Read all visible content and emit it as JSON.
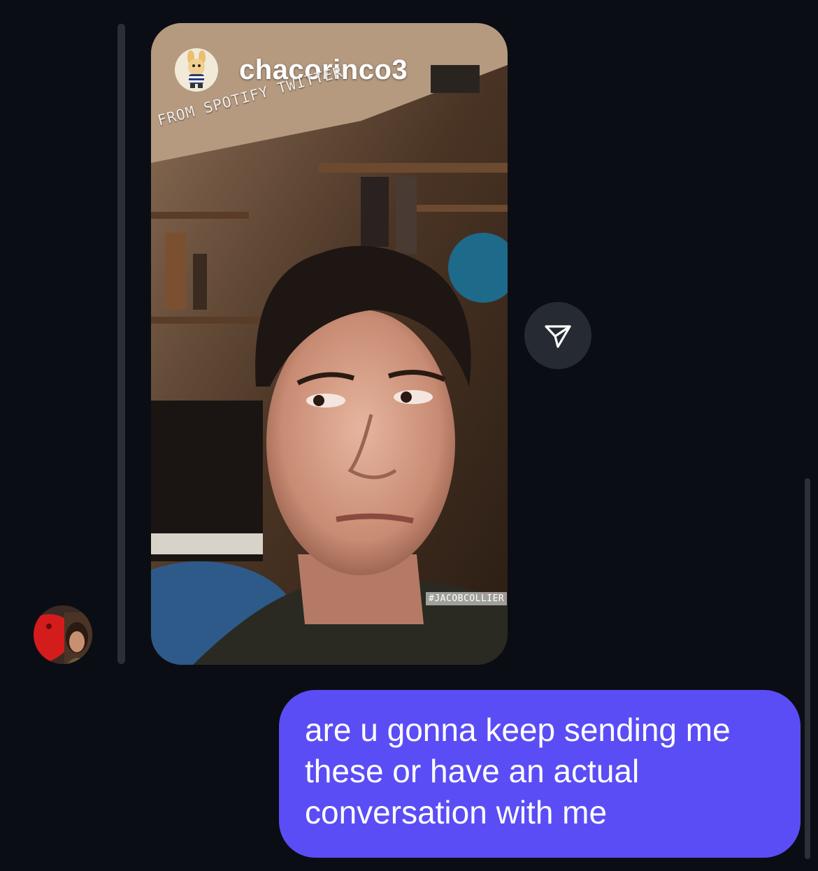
{
  "story": {
    "username": "chacorinco3",
    "caption": "FROM SPOTIFY TWITTER",
    "hashtag": "#JACOBCOLLIER",
    "avatar_icon": "cartoon-bunny-avatar"
  },
  "share_button": {
    "icon": "paper-plane-icon"
  },
  "sender": {
    "avatar_icon": "profile-photo-avatar"
  },
  "message": {
    "text": "are u gonna keep sending me these or have an actual conversation with me",
    "bubble_color": "#5b4df5"
  },
  "colors": {
    "background": "#0b0d14",
    "share_button_bg": "#262a33",
    "reply_line": "#2a2e37"
  }
}
